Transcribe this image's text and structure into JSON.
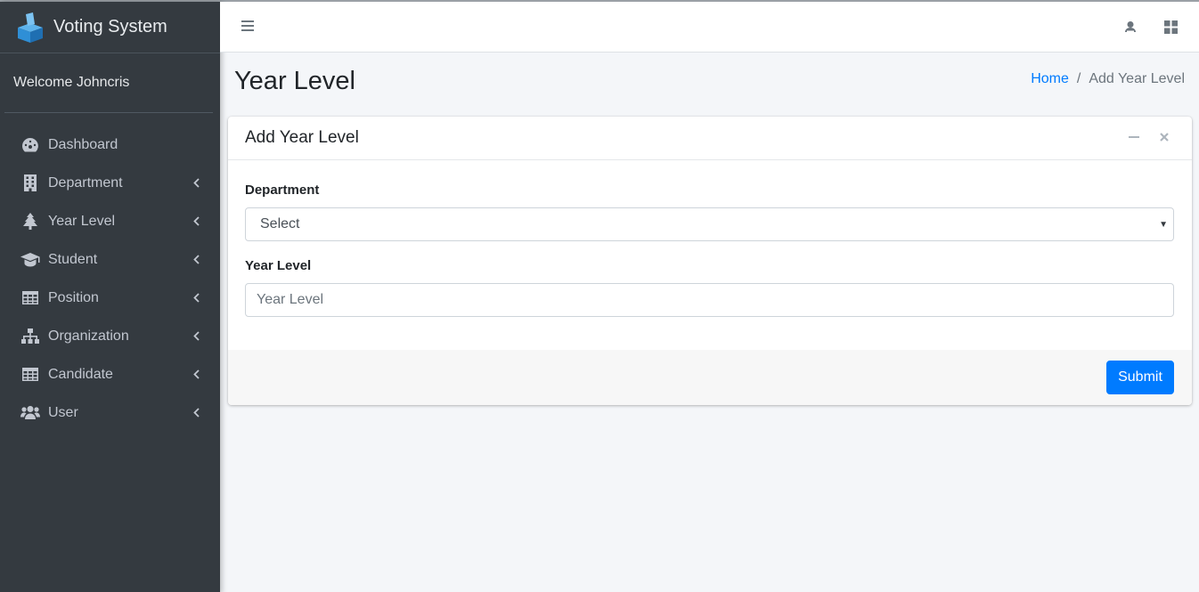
{
  "app": {
    "title": "Voting System"
  },
  "sidebar": {
    "welcome": "Welcome Johncris",
    "items": [
      {
        "label": "Dashboard",
        "icon": "dashboard-icon",
        "has_children": false
      },
      {
        "label": "Department",
        "icon": "building-icon",
        "has_children": true
      },
      {
        "label": "Year Level",
        "icon": "tree-icon",
        "has_children": true
      },
      {
        "label": "Student",
        "icon": "graduation-cap-icon",
        "has_children": true
      },
      {
        "label": "Position",
        "icon": "table-icon",
        "has_children": true
      },
      {
        "label": "Organization",
        "icon": "sitemap-icon",
        "has_children": true
      },
      {
        "label": "Candidate",
        "icon": "table-icon",
        "has_children": true
      },
      {
        "label": "User",
        "icon": "users-icon",
        "has_children": true
      }
    ]
  },
  "page": {
    "title": "Year Level",
    "breadcrumb": {
      "home": "Home",
      "separator": "/",
      "current": "Add Year Level"
    }
  },
  "card": {
    "title": "Add Year Level",
    "department": {
      "label": "Department",
      "value": "Select"
    },
    "year_level": {
      "label": "Year Level",
      "placeholder": "Year Level",
      "value": ""
    },
    "submit_label": "Submit"
  },
  "colors": {
    "sidebar_bg": "#343a40",
    "accent": "#007bff",
    "content_bg": "#f4f6f9"
  }
}
